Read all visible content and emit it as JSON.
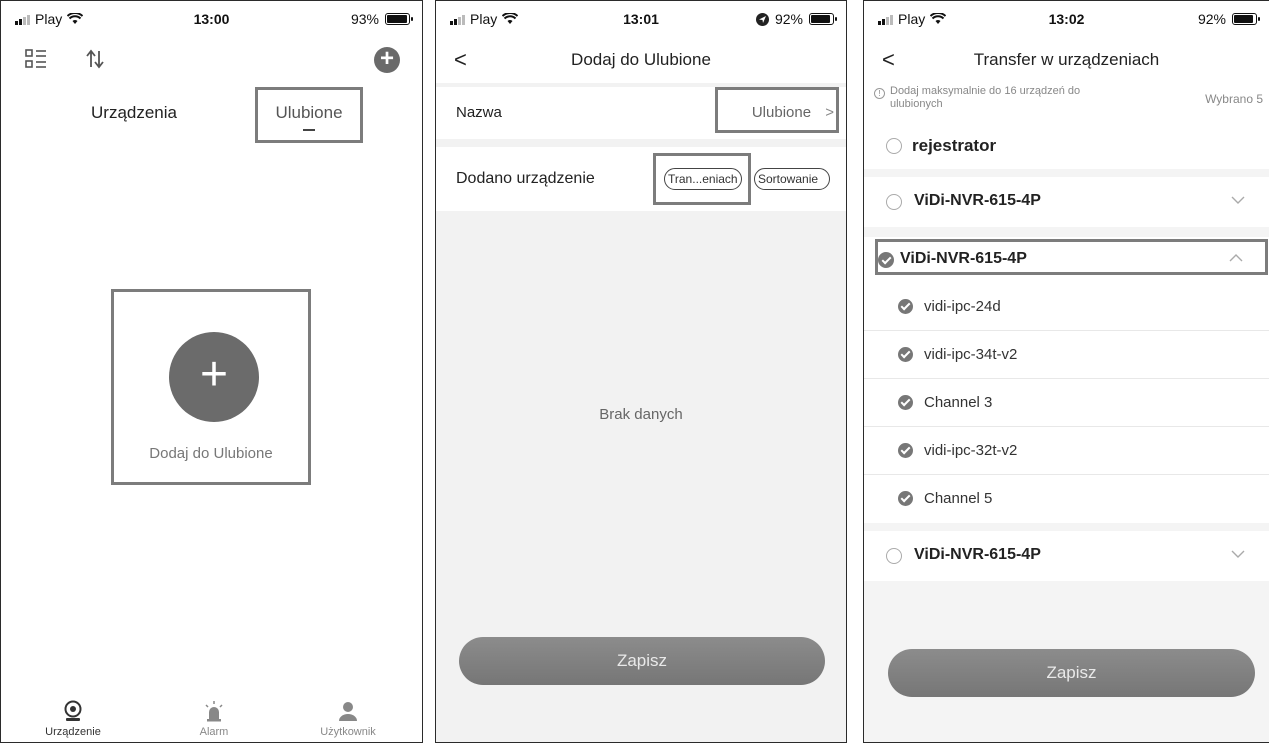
{
  "panel1": {
    "status": {
      "carrier": "Play",
      "time": "13:00",
      "battery": "93%",
      "battery_level": 0.93
    },
    "tabs": {
      "devices": "Urządzenia",
      "favorites": "Ulubione"
    },
    "add_label": "Dodaj do Ulubione",
    "add_symbol": "+",
    "nav": {
      "device": "Urządzenie",
      "alarm": "Alarm",
      "user": "Użytkownik"
    }
  },
  "panel2": {
    "status": {
      "carrier": "Play",
      "time": "13:01",
      "battery": "92%",
      "battery_level": 0.92
    },
    "title": "Dodaj do Ulubione",
    "back": "<",
    "name_label": "Nazwa",
    "name_value": "Ulubione",
    "chevron": ">",
    "added_label": "Dodano urządzenie",
    "transfer_pill": "Tran...eniach",
    "sort_pill": "Sortowanie",
    "empty": "Brak danych",
    "save": "Zapisz"
  },
  "panel3": {
    "status": {
      "carrier": "Play",
      "time": "13:02",
      "battery": "92%",
      "battery_level": 0.92
    },
    "title": "Transfer w urządzeniach",
    "back": "<",
    "hint": "Dodaj maksymalnie do 16 urządzeń do ulubionych",
    "selected": "Wybrano 5",
    "devices": [
      {
        "name": "rejestrator",
        "checked": false
      },
      {
        "name": "ViDi-NVR-615-4P",
        "checked": false,
        "expanded": false
      },
      {
        "name": "ViDi-NVR-615-4P",
        "checked": true,
        "expanded": true
      },
      {
        "name": "ViDi-NVR-615-4P",
        "checked": false,
        "expanded": false
      }
    ],
    "channels": [
      "vidi-ipc-24d",
      "vidi-ipc-34t-v2",
      "Channel 3",
      "vidi-ipc-32t-v2",
      "Channel 5"
    ],
    "save": "Zapisz"
  }
}
